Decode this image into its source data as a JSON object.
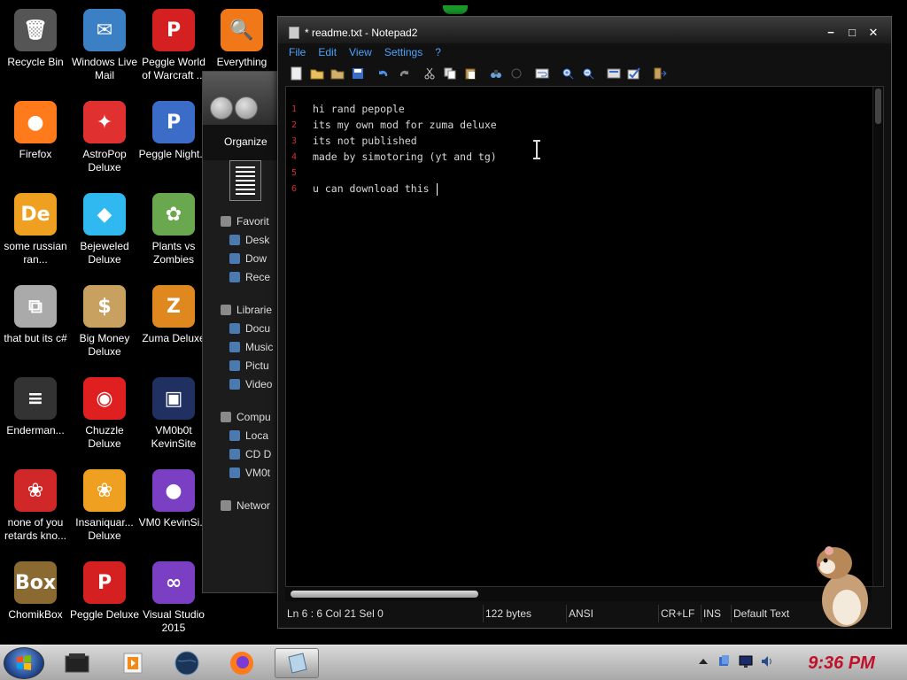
{
  "desktop": {
    "icons": [
      {
        "label": "Recycle Bin",
        "icon": "recycle-bin-icon",
        "color": "#555555"
      },
      {
        "label": "Windows Live Mail",
        "icon": "mail-icon",
        "color": "#3b7fc4"
      },
      {
        "label": "Peggle World of Warcraft ...",
        "icon": "peggle-icon",
        "color": "#d42020"
      },
      {
        "label": "Everything",
        "icon": "magnifier-icon",
        "color": "#f07818"
      },
      {
        "label": "Firefox",
        "icon": "firefox-icon",
        "color": "#ff7a1a"
      },
      {
        "label": "AstroPop Deluxe",
        "icon": "astropop-icon",
        "color": "#e03030"
      },
      {
        "label": "Peggle Night...",
        "icon": "peggle-night-icon",
        "color": "#3a6cc8"
      },
      {
        "label": "some russian ran...",
        "icon": "de-icon",
        "color": "#f0a020"
      },
      {
        "label": "Bejeweled Deluxe",
        "icon": "diamond-icon",
        "color": "#30b8f0"
      },
      {
        "label": "Plants vs Zombies",
        "icon": "plant-icon",
        "color": "#6aa84f"
      },
      {
        "label": "that but its c#",
        "icon": "windows-stack-icon",
        "color": "#aaaaaa"
      },
      {
        "label": "Big Money Deluxe",
        "icon": "money-bag-icon",
        "color": "#c8a060"
      },
      {
        "label": "Zuma Deluxe",
        "icon": "zuma-icon",
        "color": "#e08820"
      },
      {
        "label": "Enderman...",
        "icon": "terminal-icon",
        "color": "#333333"
      },
      {
        "label": "Chuzzle Deluxe",
        "icon": "chuzzle-icon",
        "color": "#e02020"
      },
      {
        "label": "VM0b0t KevinSite",
        "icon": "vm-icon",
        "color": "#203060"
      },
      {
        "label": "none of you retards kno...",
        "icon": "dragon-icon",
        "color": "#d02828"
      },
      {
        "label": "Insaniquar... Deluxe",
        "icon": "fish-icon",
        "color": "#f0a020"
      },
      {
        "label": "VM0 KevinSi...",
        "icon": "file-firefox-icon",
        "color": "#7b3fc4"
      },
      {
        "label": "ChomikBox",
        "icon": "chomik-icon",
        "color": "#8a6a30"
      },
      {
        "label": "Peggle Deluxe",
        "icon": "peggle-deluxe-icon",
        "color": "#d42020"
      },
      {
        "label": "Visual Studio 2015",
        "icon": "visual-studio-icon",
        "color": "#7b3fc4"
      }
    ]
  },
  "explorer": {
    "organize_label": "Organize",
    "tree": [
      {
        "label": "Favorit",
        "kind": "head",
        "icon": "star-icon"
      },
      {
        "label": "Desk",
        "kind": "sub",
        "icon": "desktop-icon"
      },
      {
        "label": "Dow",
        "kind": "sub",
        "icon": "download-icon"
      },
      {
        "label": "Rece",
        "kind": "sub",
        "icon": "recent-icon"
      },
      {
        "label": "",
        "kind": "gap",
        "icon": ""
      },
      {
        "label": "Librarie",
        "kind": "head",
        "icon": "library-icon"
      },
      {
        "label": "Docu",
        "kind": "sub",
        "icon": "document-icon"
      },
      {
        "label": "Music",
        "kind": "sub",
        "icon": "music-icon"
      },
      {
        "label": "Pictu",
        "kind": "sub",
        "icon": "picture-icon"
      },
      {
        "label": "Video",
        "kind": "sub",
        "icon": "video-icon"
      },
      {
        "label": "",
        "kind": "gap",
        "icon": ""
      },
      {
        "label": "Compu",
        "kind": "head",
        "icon": "computer-icon"
      },
      {
        "label": "Loca",
        "kind": "sub",
        "icon": "drive-icon"
      },
      {
        "label": "CD D",
        "kind": "sub",
        "icon": "cd-drive-icon"
      },
      {
        "label": "VM0t",
        "kind": "sub",
        "icon": "network-drive-icon"
      },
      {
        "label": "",
        "kind": "gap",
        "icon": ""
      },
      {
        "label": "Networ",
        "kind": "head",
        "icon": "network-icon"
      }
    ]
  },
  "notepad": {
    "title": "* readme.txt - Notepad2",
    "menu": [
      "File",
      "Edit",
      "View",
      "Settings",
      "?"
    ],
    "lines": [
      {
        "num": "1",
        "text": "hi rand pepople"
      },
      {
        "num": "2",
        "text": "its my own mod for zuma deluxe"
      },
      {
        "num": "3",
        "text": "its not published"
      },
      {
        "num": "4",
        "text": "made by simotoring (yt and tg)"
      },
      {
        "num": "5",
        "text": ""
      },
      {
        "num": "6",
        "text": "u can download this "
      }
    ],
    "status": {
      "position": "Ln 6 : 6   Col 21   Sel 0",
      "size": "122 bytes",
      "encoding": "ANSI",
      "eol": "CR+LF",
      "mode": "INS",
      "scheme": "Default Text"
    }
  },
  "taskbar": {
    "clock": "9:36 PM",
    "clock_color": "#c0102a"
  }
}
